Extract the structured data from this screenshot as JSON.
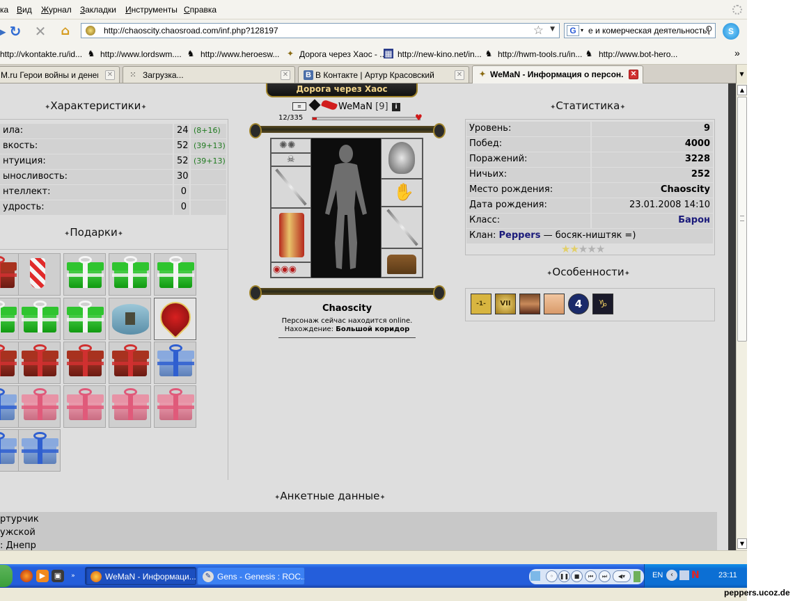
{
  "menu": [
    "ка",
    "Вид",
    "Журнал",
    "Закладки",
    "Инструменты",
    "Справка"
  ],
  "navigation": {
    "url": "http://chaoscity.chaosroad.com/inf.php?128197",
    "search_engine": "G",
    "search_text": "е и комерческая деятельность!",
    "skype_label": "S"
  },
  "bookmarks": [
    "http://vkontakte.ru/id...",
    "http://www.lordswm....",
    "http://www.heroesw...",
    "Дорога через Хаос - ...",
    "http://new-kino.net/in...",
    "http://hwm-tools.ru/in...",
    "http://www.bot-hero..."
  ],
  "bookmarks_overflow": "»",
  "tabs": [
    {
      "label": "M.ru Герои войны и денег. ...",
      "active": false
    },
    {
      "label": "Загрузка...",
      "active": false
    },
    {
      "label": "В Контакте | Артур Красовский",
      "active": false
    },
    {
      "label": "WeMaN - Информация о персон...",
      "active": true
    }
  ],
  "page": {
    "banner": "Дорога через Хаос",
    "characteristics": {
      "title": "Характеристики",
      "rows": [
        {
          "label": "ила:",
          "value": "24",
          "bonus": "(8+16)"
        },
        {
          "label": "вкость:",
          "value": "52",
          "bonus": "(39+13)"
        },
        {
          "label": "нтуиция:",
          "value": "52",
          "bonus": "(39+13)"
        },
        {
          "label": "ыносливость:",
          "value": "30",
          "bonus": ""
        },
        {
          "label": "нтеллект:",
          "value": "0",
          "bonus": ""
        },
        {
          "label": "удрость:",
          "value": "0",
          "bonus": ""
        }
      ]
    },
    "gifts": {
      "title": "Подарки",
      "items": [
        [
          "red-gift",
          "stocking",
          "green-gift",
          "green-gift",
          "green-gift"
        ],
        [
          "green-gift",
          "green-gift",
          "green-gift",
          "round-box",
          "heart-box"
        ],
        [
          "red-gift",
          "red-gift",
          "red-gift",
          "red-gift",
          "blue-gift"
        ],
        [
          "blue-gift",
          "pink-gift",
          "pink-gift",
          "pink-gift",
          "pink-gift"
        ],
        [
          "blue-gift",
          "blue-gift"
        ]
      ]
    },
    "character": {
      "name": "WeMaN",
      "level": "[9]",
      "hp": "12/335",
      "hp_fraction": 0.036,
      "city": "Chaoscity",
      "status_text": "Персонаж сейчас находится online.",
      "location_label": "Нахождение:",
      "location_value": "Большой коридор"
    },
    "statistics": {
      "title": "Статистика",
      "rows": [
        {
          "label": "Уровень:",
          "value": "9"
        },
        {
          "label": "Побед:",
          "value": "4000"
        },
        {
          "label": "Поражений:",
          "value": "3228"
        },
        {
          "label": "Ничьих:",
          "value": "252"
        },
        {
          "label": "Место рождения:",
          "value": "Chaoscity"
        },
        {
          "label": "Дата рождения:",
          "value": "23.01.2008 14:10"
        },
        {
          "label": "Класс:",
          "value": "Барон"
        }
      ],
      "clan_label": "Клан:",
      "clan_name": "Peppers",
      "clan_motto": "— босяк-ништяк =)",
      "stars_filled": 2,
      "stars_total": 5
    },
    "features": {
      "title": "Особенности",
      "icons": [
        "-1-",
        "VII",
        "",
        "",
        "4",
        "♑"
      ]
    },
    "profile": {
      "title": "Анкетные данные",
      "lines": [
        "ртурчик",
        "ужской",
        ": Днепр"
      ]
    }
  },
  "taskbar": {
    "tasks": [
      {
        "label": "WeMaN - Информаци...",
        "active": true
      },
      {
        "label": "Gens - Genesis : ROC...",
        "active": false
      }
    ],
    "lang": "EN",
    "clock": "23:11"
  },
  "watermark": "peppers.ucoz.de",
  "colors": {
    "content_bg": "#dedede",
    "table_cell": "#d2d2d2",
    "bonus": "#1f7a1f",
    "clan": "#1a1a7a",
    "taskbar": "#245edb"
  }
}
